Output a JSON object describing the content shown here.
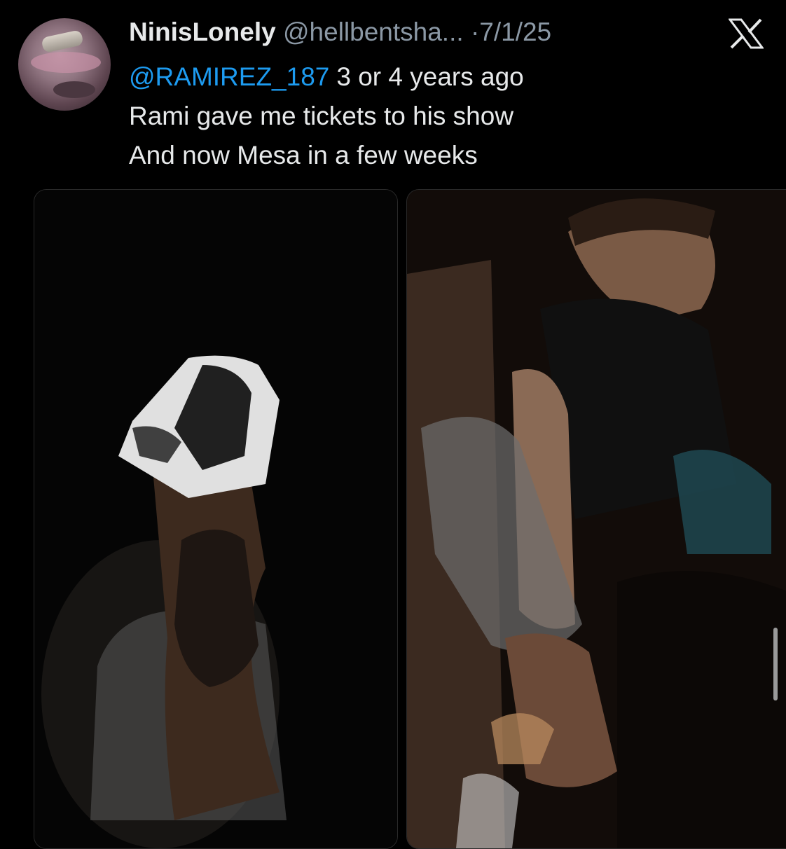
{
  "tweet": {
    "display_name": "NinisLonely",
    "handle": "@hellbentsha...",
    "separator": "·",
    "date": "7/1/25",
    "reply_mention": "@RAMIREZ_187",
    "line1_rest": "3 or 4 years ago",
    "line2": "Rami gave me tickets to his show",
    "line3": "And now Mesa in a few weeks"
  },
  "icons": {
    "platform": "x-logo-icon",
    "avatar": "profile-avatar"
  },
  "media": {
    "count": 2,
    "left": "forearm-portrait-tattoo-with-reference-photo",
    "right": "crowd-photo-showing-tattooed-arm"
  },
  "colors": {
    "background": "#000000",
    "text": "#e7e9ea",
    "secondary": "#8b98a5",
    "link": "#1d9bf0"
  }
}
